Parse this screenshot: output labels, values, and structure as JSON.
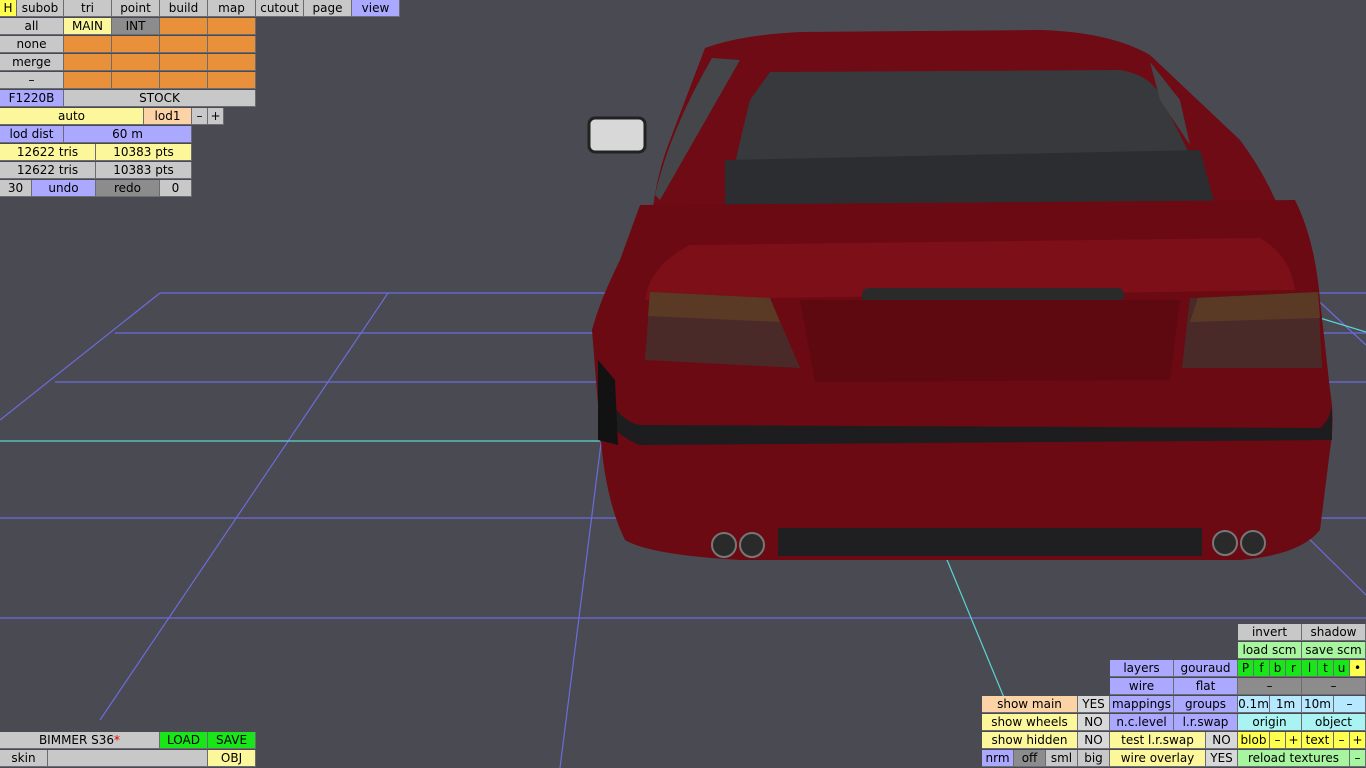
{
  "menu": {
    "items": [
      "H",
      "subob",
      "tri",
      "point",
      "build",
      "map",
      "cutout",
      "page",
      "view"
    ],
    "active": "view"
  },
  "select_panel": {
    "rows": [
      "all",
      "none",
      "merge",
      "–"
    ],
    "main_label": "MAIN",
    "int_label": "INT"
  },
  "model_id": "F1220B",
  "variant": "STOCK",
  "lod": {
    "mode": "auto",
    "level": "lod1",
    "minus": "–",
    "plus": "+",
    "dist_label": "lod dist",
    "dist_value": "60 m"
  },
  "stats": {
    "row1": {
      "tris": "12622 tris",
      "pts": "10383 pts"
    },
    "row2": {
      "tris": "12622 tris",
      "pts": "10383 pts"
    }
  },
  "undo": {
    "count": "30",
    "undo": "undo",
    "redo": "redo",
    "redo_count": "0"
  },
  "file": {
    "name": "BIMMER S36",
    "modified_mark": "*",
    "load": "LOAD",
    "save": "SAVE",
    "skin": "skin",
    "obj": "OBJ"
  },
  "bottom_right": {
    "invert": "invert",
    "shadow": "shadow",
    "load_scm": "load scm",
    "save_scm": "save scm",
    "layers": "layers",
    "gouraud": "gouraud",
    "pf_letters": [
      "P",
      "f",
      "b",
      "r",
      "l",
      "t",
      "u",
      "•"
    ],
    "wire": "wire",
    "flat": "flat",
    "dash1": "–",
    "dash2": "–",
    "show_main": "show main",
    "show_main_val": "YES",
    "mappings": "mappings",
    "groups": "groups",
    "d01": "0.1m",
    "d1": "1m",
    "d10": "10m",
    "dminus": "–",
    "show_wheels": "show wheels",
    "show_wheels_val": "NO",
    "nclevel": "n.c.level",
    "lrswap": "l.r.swap",
    "origin": "origin",
    "object": "object",
    "show_hidden": "show hidden",
    "show_hidden_val": "NO",
    "test_lrswap": "test l.r.swap",
    "test_val": "NO",
    "blob": "blob",
    "blob_minus": "–",
    "blob_plus": "+",
    "text": "text",
    "text_minus": "–",
    "text_plus": "+",
    "nrm": "nrm",
    "off": "off",
    "sml": "sml",
    "big": "big",
    "wire_overlay": "wire overlay",
    "wire_overlay_val": "YES",
    "reload": "reload textures",
    "reload_minus": "–"
  },
  "colors": {
    "viewport_bg": "#4a4b52",
    "car_body": "#6b0a12",
    "grid": "#6b6bdc",
    "axis": "#5ad4d4"
  }
}
